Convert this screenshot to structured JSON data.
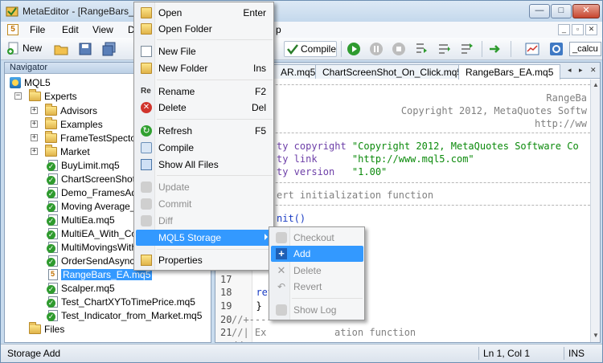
{
  "window": {
    "title": "MetaEditor - [RangeBars_EA",
    "accent": "#3399ff"
  },
  "menubar": {
    "items": [
      "File",
      "Edit",
      "View",
      "D",
      "p"
    ]
  },
  "toolbar": {
    "new_label": "New",
    "compile_label": "Compile",
    "field_value": "_calcu"
  },
  "navigator": {
    "title": "Navigator",
    "root": "MQL5",
    "experts": "Experts",
    "folders": [
      "Advisors",
      "Examples",
      "FrameTestSpectog",
      "Market"
    ],
    "files": [
      "BuyLimit.mq5",
      "ChartScreenShot_C",
      "Demo_FramesAdd",
      "Moving Average_F",
      "MultiEa.mq5",
      "MultiEA_With_Col",
      "MultiMovingsWith",
      "OrderSendAsync_D",
      "RangeBars_EA.mq5",
      "Scalper.mq5",
      "Test_ChartXYToTimePrice.mq5",
      "Test_Indicator_from_Market.mq5"
    ],
    "files_folder": "Files"
  },
  "editor": {
    "tabs": [
      "AR.mq5",
      "ChartScreenShot_On_Click.mq5",
      "RangeBars_EA.mq5"
    ],
    "lines": {
      "l1": "RangeBa",
      "l2": "Copyright 2012, MetaQuotes Softw",
      "l3": "http://ww",
      "p1a": "ty copyright ",
      "p1b": "\"Copyright 2012, MetaQuotes Software Co",
      "p2a": "ty link      ",
      "p2b": "\"http://www.mql5.com\"",
      "p3a": "ty version   ",
      "p3b": "\"1.00\"",
      "c1": "ert initialization function",
      "fn": "nit()",
      "ret": "  ret",
      "brace": "  }",
      "cm1": "//+----",
      "cm2": "//| Ex",
      "cm2b": "ation function",
      "cm3": "//+--"
    },
    "line_numbers": [
      "17",
      "18",
      "19",
      "20",
      "21"
    ]
  },
  "context_menu": {
    "open": "Open",
    "open_sc": "Enter",
    "open_folder": "Open Folder",
    "new_file": "New File",
    "new_folder": "New Folder",
    "new_folder_sc": "Ins",
    "rename": "Rename",
    "rename_sc": "F2",
    "delete": "Delete",
    "delete_sc": "Del",
    "refresh": "Refresh",
    "refresh_sc": "F5",
    "compile": "Compile",
    "show_all": "Show All Files",
    "update": "Update",
    "commit": "Commit",
    "diff": "Diff",
    "storage": "MQL5 Storage",
    "properties": "Properties"
  },
  "submenu": {
    "checkout": "Checkout",
    "add": "Add",
    "delete": "Delete",
    "revert": "Revert",
    "show_log": "Show Log"
  },
  "status": {
    "text": "Storage Add",
    "position": "Ln 1, Col 1",
    "mode": "INS"
  }
}
